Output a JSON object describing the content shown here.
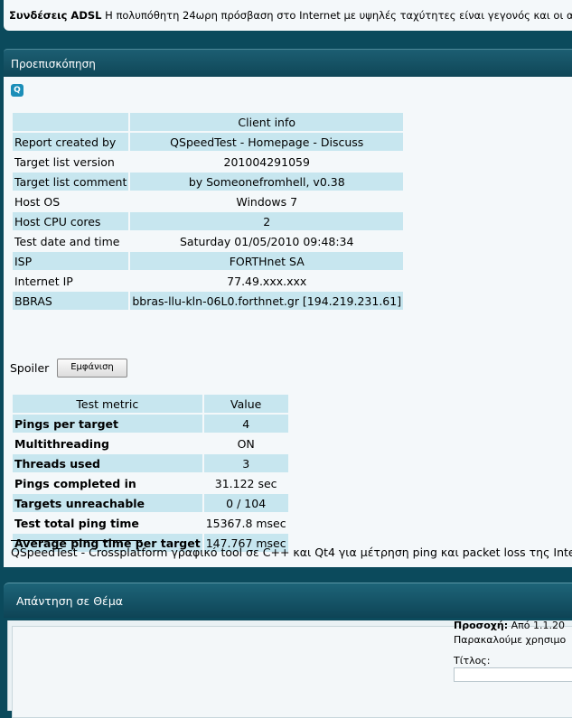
{
  "banner": {
    "title": "Συνδέσεις ADSL",
    "text": " Η πολυπόθητη 24ωρη πρόσβαση στο Internet με υψηλές ταχύτητες είναι γεγονός και οι απ"
  },
  "preview": {
    "header": "Προεπισκόπηση",
    "client_info": {
      "heading": "Client info",
      "rows": [
        {
          "label": "Report created by",
          "value": "QSpeedTest - Homepage - Discuss"
        },
        {
          "label": "Target list version",
          "value": "201004291059"
        },
        {
          "label": "Target list comment",
          "value": "by Someonefromhell, v0.38"
        },
        {
          "label": "Host OS",
          "value": "Windows 7"
        },
        {
          "label": "Host CPU cores",
          "value": "2"
        },
        {
          "label": "Test date and time",
          "value": "Saturday 01/05/2010 09:48:34"
        },
        {
          "label": "ISP",
          "value": "FORTHnet SA"
        },
        {
          "label": "Internet IP",
          "value": "77.49.xxx.xxx"
        },
        {
          "label": "BBRAS",
          "value": "bbras-llu-kln-06L0.forthnet.gr [194.219.231.61]"
        }
      ]
    },
    "spoiler": {
      "label": "Spoiler",
      "button": "Εμφάνιση"
    },
    "metrics": {
      "col_metric": "Test metric",
      "col_value": "Value",
      "rows": [
        {
          "label": "Pings per target",
          "value": "4"
        },
        {
          "label": "Multithreading",
          "value": "ON"
        },
        {
          "label": "Threads used",
          "value": "3"
        },
        {
          "label": "Pings completed in",
          "value": "31.122 sec"
        },
        {
          "label": "Targets unreachable",
          "value": "0 / 104"
        },
        {
          "label": "Test total ping time",
          "value": "15367.8 msec"
        },
        {
          "label": "Average ping time per target",
          "value": "147.767 msec"
        }
      ]
    },
    "signature": "QSpeedTest - Crossplatform γραφικό tool σε C++ και Qt4 για μέτρηση ping και packet loss της Inte"
  },
  "reply": {
    "header": "Απάντηση σε Θέμα",
    "notice_bold": "Προσοχή:",
    "notice_1": " Από 1.1.20",
    "notice_2": "Παρακαλούμε χρησιμο",
    "title_label": "Τίτλος:"
  }
}
